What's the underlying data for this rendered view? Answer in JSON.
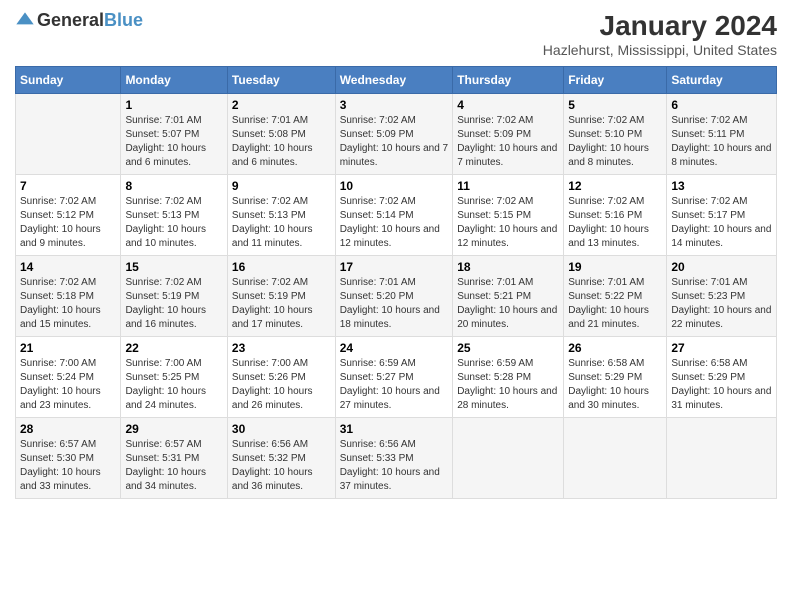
{
  "logo": {
    "general": "General",
    "blue": "Blue"
  },
  "title": "January 2024",
  "subtitle": "Hazlehurst, Mississippi, United States",
  "days_of_week": [
    "Sunday",
    "Monday",
    "Tuesday",
    "Wednesday",
    "Thursday",
    "Friday",
    "Saturday"
  ],
  "weeks": [
    [
      {
        "day": "",
        "sunrise": "",
        "sunset": "",
        "daylight": ""
      },
      {
        "day": "1",
        "sunrise": "Sunrise: 7:01 AM",
        "sunset": "Sunset: 5:07 PM",
        "daylight": "Daylight: 10 hours and 6 minutes."
      },
      {
        "day": "2",
        "sunrise": "Sunrise: 7:01 AM",
        "sunset": "Sunset: 5:08 PM",
        "daylight": "Daylight: 10 hours and 6 minutes."
      },
      {
        "day": "3",
        "sunrise": "Sunrise: 7:02 AM",
        "sunset": "Sunset: 5:09 PM",
        "daylight": "Daylight: 10 hours and 7 minutes."
      },
      {
        "day": "4",
        "sunrise": "Sunrise: 7:02 AM",
        "sunset": "Sunset: 5:09 PM",
        "daylight": "Daylight: 10 hours and 7 minutes."
      },
      {
        "day": "5",
        "sunrise": "Sunrise: 7:02 AM",
        "sunset": "Sunset: 5:10 PM",
        "daylight": "Daylight: 10 hours and 8 minutes."
      },
      {
        "day": "6",
        "sunrise": "Sunrise: 7:02 AM",
        "sunset": "Sunset: 5:11 PM",
        "daylight": "Daylight: 10 hours and 8 minutes."
      }
    ],
    [
      {
        "day": "7",
        "sunrise": "Sunrise: 7:02 AM",
        "sunset": "Sunset: 5:12 PM",
        "daylight": "Daylight: 10 hours and 9 minutes."
      },
      {
        "day": "8",
        "sunrise": "Sunrise: 7:02 AM",
        "sunset": "Sunset: 5:13 PM",
        "daylight": "Daylight: 10 hours and 10 minutes."
      },
      {
        "day": "9",
        "sunrise": "Sunrise: 7:02 AM",
        "sunset": "Sunset: 5:13 PM",
        "daylight": "Daylight: 10 hours and 11 minutes."
      },
      {
        "day": "10",
        "sunrise": "Sunrise: 7:02 AM",
        "sunset": "Sunset: 5:14 PM",
        "daylight": "Daylight: 10 hours and 12 minutes."
      },
      {
        "day": "11",
        "sunrise": "Sunrise: 7:02 AM",
        "sunset": "Sunset: 5:15 PM",
        "daylight": "Daylight: 10 hours and 12 minutes."
      },
      {
        "day": "12",
        "sunrise": "Sunrise: 7:02 AM",
        "sunset": "Sunset: 5:16 PM",
        "daylight": "Daylight: 10 hours and 13 minutes."
      },
      {
        "day": "13",
        "sunrise": "Sunrise: 7:02 AM",
        "sunset": "Sunset: 5:17 PM",
        "daylight": "Daylight: 10 hours and 14 minutes."
      }
    ],
    [
      {
        "day": "14",
        "sunrise": "Sunrise: 7:02 AM",
        "sunset": "Sunset: 5:18 PM",
        "daylight": "Daylight: 10 hours and 15 minutes."
      },
      {
        "day": "15",
        "sunrise": "Sunrise: 7:02 AM",
        "sunset": "Sunset: 5:19 PM",
        "daylight": "Daylight: 10 hours and 16 minutes."
      },
      {
        "day": "16",
        "sunrise": "Sunrise: 7:02 AM",
        "sunset": "Sunset: 5:19 PM",
        "daylight": "Daylight: 10 hours and 17 minutes."
      },
      {
        "day": "17",
        "sunrise": "Sunrise: 7:01 AM",
        "sunset": "Sunset: 5:20 PM",
        "daylight": "Daylight: 10 hours and 18 minutes."
      },
      {
        "day": "18",
        "sunrise": "Sunrise: 7:01 AM",
        "sunset": "Sunset: 5:21 PM",
        "daylight": "Daylight: 10 hours and 20 minutes."
      },
      {
        "day": "19",
        "sunrise": "Sunrise: 7:01 AM",
        "sunset": "Sunset: 5:22 PM",
        "daylight": "Daylight: 10 hours and 21 minutes."
      },
      {
        "day": "20",
        "sunrise": "Sunrise: 7:01 AM",
        "sunset": "Sunset: 5:23 PM",
        "daylight": "Daylight: 10 hours and 22 minutes."
      }
    ],
    [
      {
        "day": "21",
        "sunrise": "Sunrise: 7:00 AM",
        "sunset": "Sunset: 5:24 PM",
        "daylight": "Daylight: 10 hours and 23 minutes."
      },
      {
        "day": "22",
        "sunrise": "Sunrise: 7:00 AM",
        "sunset": "Sunset: 5:25 PM",
        "daylight": "Daylight: 10 hours and 24 minutes."
      },
      {
        "day": "23",
        "sunrise": "Sunrise: 7:00 AM",
        "sunset": "Sunset: 5:26 PM",
        "daylight": "Daylight: 10 hours and 26 minutes."
      },
      {
        "day": "24",
        "sunrise": "Sunrise: 6:59 AM",
        "sunset": "Sunset: 5:27 PM",
        "daylight": "Daylight: 10 hours and 27 minutes."
      },
      {
        "day": "25",
        "sunrise": "Sunrise: 6:59 AM",
        "sunset": "Sunset: 5:28 PM",
        "daylight": "Daylight: 10 hours and 28 minutes."
      },
      {
        "day": "26",
        "sunrise": "Sunrise: 6:58 AM",
        "sunset": "Sunset: 5:29 PM",
        "daylight": "Daylight: 10 hours and 30 minutes."
      },
      {
        "day": "27",
        "sunrise": "Sunrise: 6:58 AM",
        "sunset": "Sunset: 5:29 PM",
        "daylight": "Daylight: 10 hours and 31 minutes."
      }
    ],
    [
      {
        "day": "28",
        "sunrise": "Sunrise: 6:57 AM",
        "sunset": "Sunset: 5:30 PM",
        "daylight": "Daylight: 10 hours and 33 minutes."
      },
      {
        "day": "29",
        "sunrise": "Sunrise: 6:57 AM",
        "sunset": "Sunset: 5:31 PM",
        "daylight": "Daylight: 10 hours and 34 minutes."
      },
      {
        "day": "30",
        "sunrise": "Sunrise: 6:56 AM",
        "sunset": "Sunset: 5:32 PM",
        "daylight": "Daylight: 10 hours and 36 minutes."
      },
      {
        "day": "31",
        "sunrise": "Sunrise: 6:56 AM",
        "sunset": "Sunset: 5:33 PM",
        "daylight": "Daylight: 10 hours and 37 minutes."
      },
      {
        "day": "",
        "sunrise": "",
        "sunset": "",
        "daylight": ""
      },
      {
        "day": "",
        "sunrise": "",
        "sunset": "",
        "daylight": ""
      },
      {
        "day": "",
        "sunrise": "",
        "sunset": "",
        "daylight": ""
      }
    ]
  ]
}
